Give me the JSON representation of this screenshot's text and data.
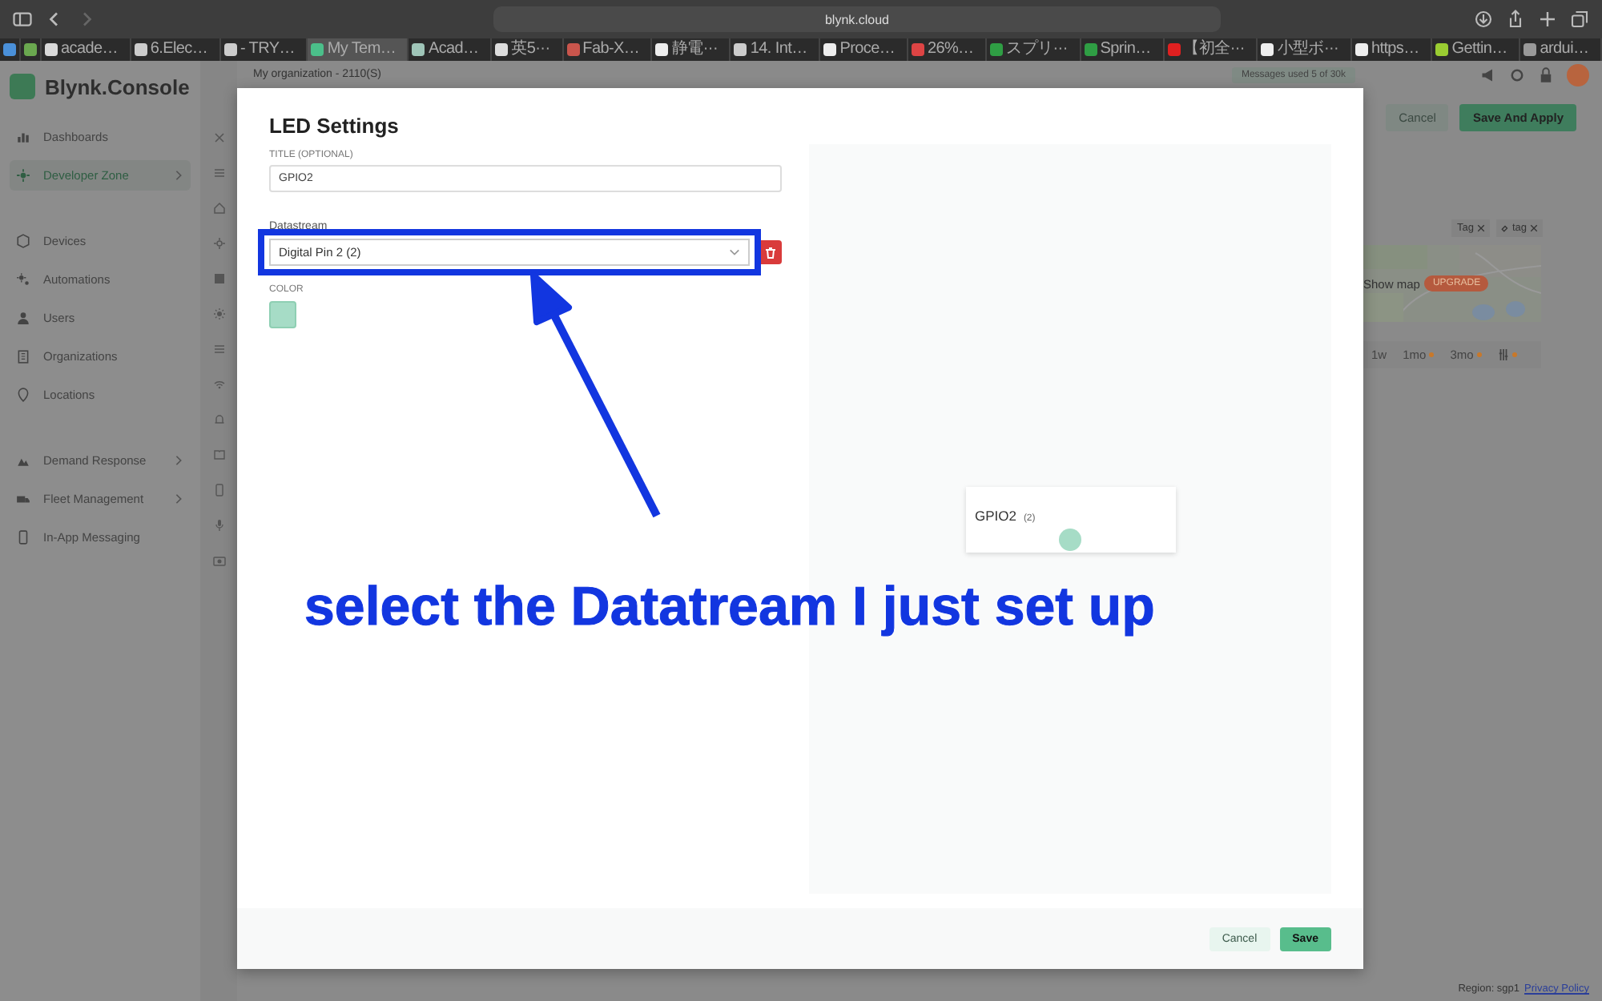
{
  "browser": {
    "address": "blynk.cloud",
    "tabs": [
      {
        "kind": "pinned",
        "selected": false
      },
      {
        "kind": "pinned",
        "selected": false
      },
      {
        "kind": "page",
        "label": "acade…",
        "selected": false
      },
      {
        "kind": "page",
        "label": "6.Elec…",
        "selected": false
      },
      {
        "kind": "page",
        "label": "- TRY…",
        "selected": false
      },
      {
        "kind": "page",
        "label": "My Tem…",
        "selected": true
      },
      {
        "kind": "page",
        "label": "Acad…",
        "selected": false
      },
      {
        "kind": "page",
        "label": "英5···",
        "selected": false
      },
      {
        "kind": "page",
        "label": "Fab-X…",
        "selected": false
      },
      {
        "kind": "page",
        "label": "静電···",
        "selected": false
      },
      {
        "kind": "page",
        "label": "14. Int…",
        "selected": false
      },
      {
        "kind": "page",
        "label": "Proce…",
        "selected": false
      },
      {
        "kind": "page",
        "label": "26%…",
        "selected": false
      },
      {
        "kind": "page",
        "label": "スプリ···",
        "selected": false
      },
      {
        "kind": "page",
        "label": "Sprin…",
        "selected": false
      },
      {
        "kind": "page",
        "label": "【初全···",
        "selected": false
      },
      {
        "kind": "page",
        "label": "小型ボ···",
        "selected": false
      },
      {
        "kind": "page",
        "label": "https…",
        "selected": false
      },
      {
        "kind": "page",
        "label": "Gettin…",
        "selected": false
      },
      {
        "kind": "page",
        "label": "ardui…",
        "selected": false
      }
    ]
  },
  "app": {
    "logo": "Blynk.Console",
    "organization": "My organization - 2110(S)",
    "messages": "Messages used 5 of 30k",
    "sidebar": [
      [
        {
          "label": "Dashboards",
          "selected": false,
          "expandable": false
        },
        {
          "label": "Developer Zone",
          "selected": true,
          "expandable": true
        }
      ],
      [
        {
          "label": "Devices",
          "selected": false,
          "expandable": false
        },
        {
          "label": "Automations",
          "selected": false,
          "expandable": false
        },
        {
          "label": "Users",
          "selected": false,
          "expandable": false
        },
        {
          "label": "Organizations",
          "selected": false,
          "expandable": false
        },
        {
          "label": "Locations",
          "selected": false,
          "expandable": false
        }
      ],
      [
        {
          "label": "Demand Response",
          "selected": false,
          "expandable": true
        },
        {
          "label": "Fleet Management",
          "selected": false,
          "expandable": true
        },
        {
          "label": "In-App Messaging",
          "selected": false,
          "expandable": false
        }
      ]
    ],
    "header_buttons": [
      {
        "label": "Cancel",
        "kind": "secondary"
      },
      {
        "label": "Save And Apply",
        "kind": "primary"
      }
    ],
    "tags": [
      {
        "label": "Tag",
        "kind": "plain"
      },
      {
        "label": "tag",
        "kind": "linked"
      }
    ],
    "map": {
      "kind": "picture",
      "label": "Show map",
      "badge": "UPGRADE"
    },
    "time_ranges": [
      {
        "label": "1w",
        "locked": false
      },
      {
        "label": "1mo",
        "locked": true
      },
      {
        "label": "3mo",
        "locked": true
      },
      {
        "kind": "custom",
        "locked": true
      }
    ],
    "footer": {
      "region": "Region: sgp1",
      "link": "Privacy Policy"
    }
  },
  "dialog": {
    "title": "LED Settings",
    "title_field": {
      "label": "TITLE (OPTIONAL)",
      "value": "GPIO2"
    },
    "datastream": {
      "label": "Datastream",
      "value": "Digital Pin 2 (2)"
    },
    "color": {
      "label": "COLOR",
      "color": "#a6dcc6"
    },
    "preview": {
      "name": "GPIO2",
      "pin": "(2)"
    },
    "buttons": [
      {
        "label": "Cancel",
        "kind": "secondary"
      },
      {
        "label": "Save",
        "kind": "primary"
      }
    ]
  },
  "annotation": {
    "text": "select the Datatream I just set up"
  }
}
